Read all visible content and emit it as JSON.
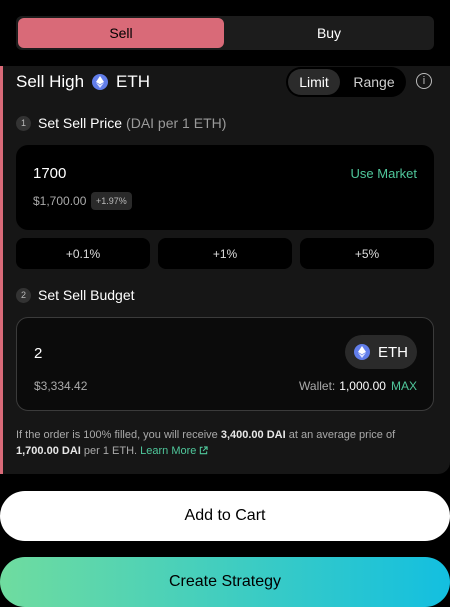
{
  "tabs": {
    "sell": "Sell",
    "buy": "Buy"
  },
  "header": {
    "title_prefix": "Sell High",
    "token": "ETH"
  },
  "mode": {
    "limit": "Limit",
    "range": "Range",
    "selected": "Limit"
  },
  "info_icon": "info-icon",
  "step1": {
    "number": "1",
    "label": "Set Sell Price",
    "sub": "(DAI per 1 ETH)"
  },
  "price": {
    "value": "1700",
    "usd": "$1,700.00",
    "change": "+1.97%",
    "use_market": "Use Market"
  },
  "presets": [
    "+0.1%",
    "+1%",
    "+5%"
  ],
  "step2": {
    "number": "2",
    "label": "Set Sell Budget"
  },
  "budget": {
    "value": "2",
    "token": "ETH",
    "usd": "$3,334.42",
    "wallet_label": "Wallet:",
    "wallet_value": "1,000.00",
    "max": "MAX"
  },
  "note": {
    "part1": "If the order is 100% filled, you will receive",
    "receive": "3,400.00 DAI",
    "part2": "at an average price of",
    "avg_price": "1,700.00 DAI",
    "part3": "per 1 ETH.",
    "learn_more": "Learn More"
  },
  "buttons": {
    "add_to_cart": "Add to Cart",
    "create_strategy": "Create Strategy"
  },
  "colors": {
    "sell_accent": "#d96a78",
    "green": "#4fc79b",
    "gradient_start": "#6fdc9f",
    "gradient_end": "#13bfe0"
  }
}
